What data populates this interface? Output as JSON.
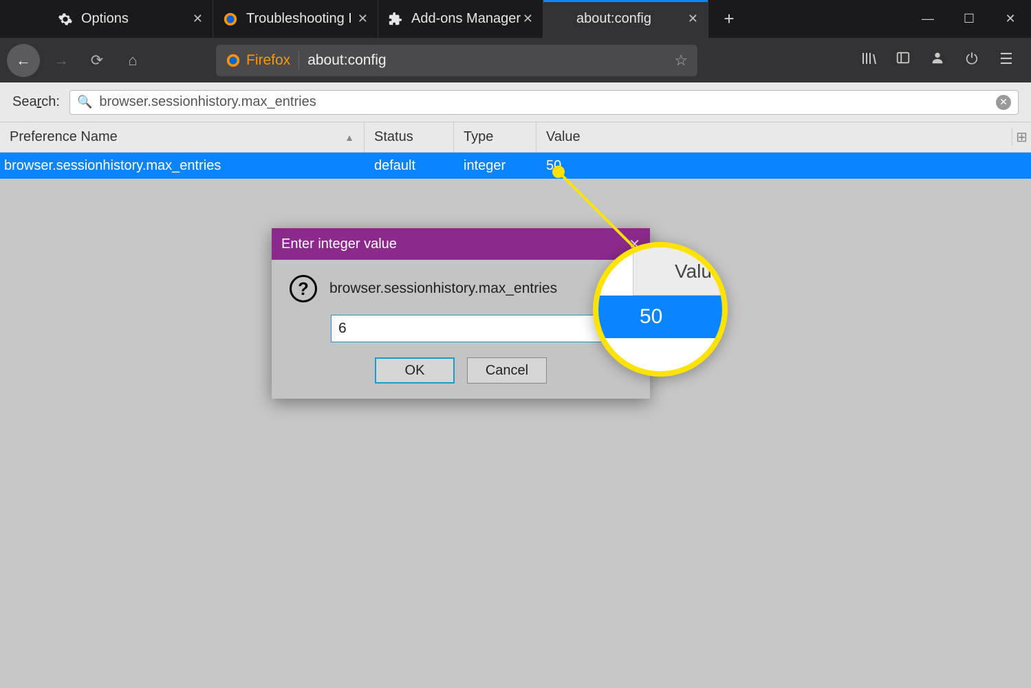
{
  "tabs": [
    {
      "label": "Options",
      "icon": "gear"
    },
    {
      "label": "Troubleshooting I",
      "icon": "firefox"
    },
    {
      "label": "Add-ons Manager",
      "icon": "puzzle"
    },
    {
      "label": "about:config",
      "icon": ""
    }
  ],
  "urlbar": {
    "identity": "Firefox",
    "url": "about:config"
  },
  "search": {
    "label_pre": "Sea",
    "label_u": "r",
    "label_post": "ch:",
    "value": "browser.sessionhistory.max_entries"
  },
  "columns": {
    "name": "Preference Name",
    "status": "Status",
    "type": "Type",
    "value": "Value"
  },
  "row": {
    "name": "browser.sessionhistory.max_entries",
    "status": "default",
    "type": "integer",
    "value": "50"
  },
  "dialog": {
    "title": "Enter integer value",
    "pref": "browser.sessionhistory.max_entries",
    "input": "6",
    "ok": "OK",
    "cancel": "Cancel"
  },
  "magnifier": {
    "header": "Value",
    "value": "50"
  }
}
